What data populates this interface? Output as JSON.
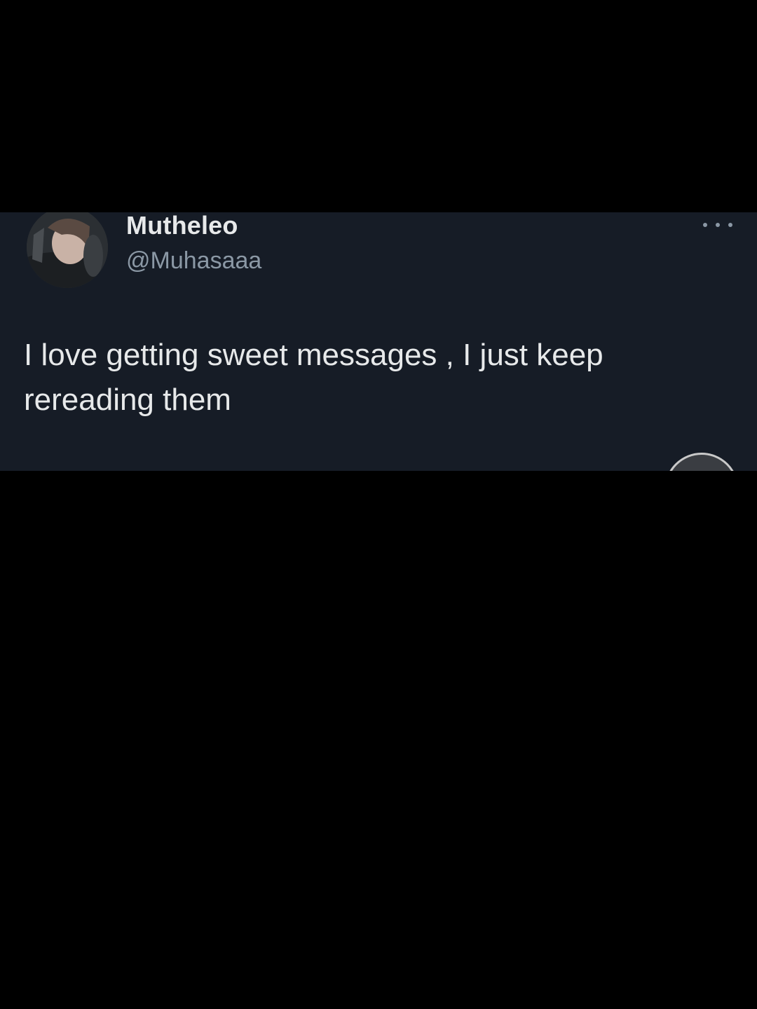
{
  "tweet": {
    "display_name": "Mutheleo",
    "handle": "@Muhasaaa",
    "text": "I love getting sweet messages , I just keep rereading them",
    "avatar_icon": "user-avatar",
    "more_icon": "more-options-icon"
  },
  "colors": {
    "page_background": "#000000",
    "card_background": "#161c26",
    "primary_text": "#e7e9ea",
    "secondary_text": "#8b98a5"
  }
}
